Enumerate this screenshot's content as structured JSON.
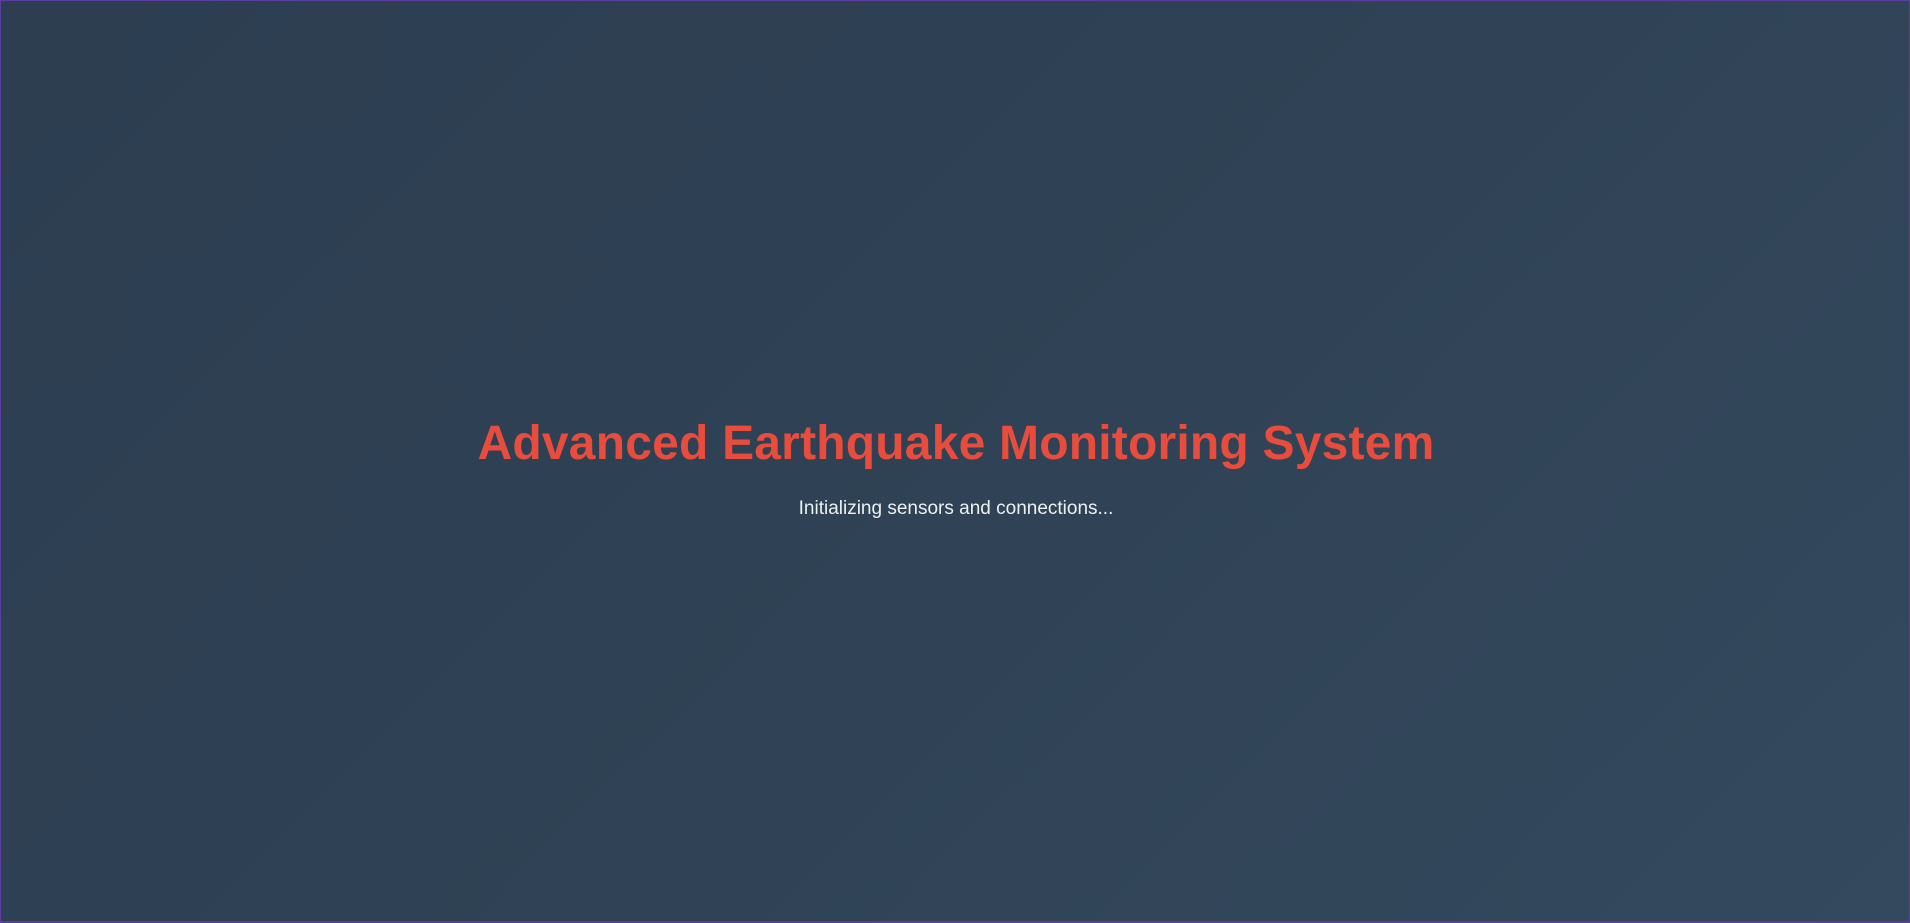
{
  "loading_screen": {
    "title": "Advanced Earthquake Monitoring System",
    "status": "Initializing sensors and connections..."
  },
  "colors": {
    "background_start": "#2c3e50",
    "background_end": "#34495e",
    "title": "#e74c3c",
    "status_text": "#ecf0f1",
    "frame_border": "#5a3fa0"
  }
}
